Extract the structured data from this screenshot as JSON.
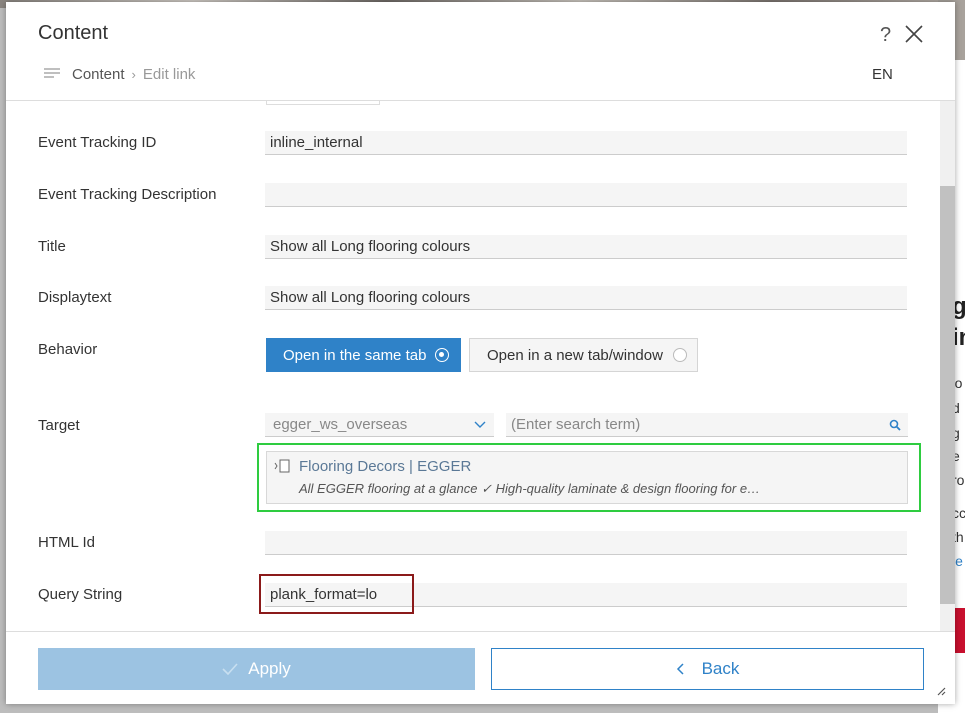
{
  "modal": {
    "title": "Content",
    "help_label": "?",
    "language": "EN",
    "breadcrumb": {
      "root": "Content",
      "separator": "›",
      "current": "Edit link"
    }
  },
  "fields": {
    "event_tracking_id": {
      "label": "Event Tracking ID",
      "value": "inline_internal"
    },
    "event_tracking_description": {
      "label": "Event Tracking Description",
      "value": ""
    },
    "title": {
      "label": "Title",
      "value": "Show all Long flooring colours"
    },
    "displaytext": {
      "label": "Displaytext",
      "value": "Show all Long flooring colours"
    },
    "behavior": {
      "label": "Behavior",
      "options": [
        "Open in the same tab",
        "Open in a new tab/window"
      ],
      "selected": "Open in the same tab"
    },
    "target": {
      "label": "Target",
      "site": "egger_ws_overseas",
      "search_placeholder": "(Enter search term)",
      "result_title": "Flooring Decors | EGGER",
      "result_description": "All EGGER flooring at a glance ✓ High-quality laminate & design flooring for e…"
    },
    "html_id": {
      "label": "HTML Id",
      "value": ""
    },
    "query_string": {
      "label": "Query String",
      "value": "plank_format=lo"
    }
  },
  "footer": {
    "apply_label": "Apply",
    "back_label": "Back"
  },
  "colors": {
    "primary": "#2f82c8",
    "apply_disabled": "#9cc3e2",
    "highlight_green": "#2ecc40",
    "highlight_red": "#8b1a1a"
  },
  "background_page": {
    "heading_fragments": [
      "g",
      "in"
    ],
    "text_fragments": [
      "'o",
      "d",
      "g",
      "e",
      "ro",
      "cc",
      "th",
      "le"
    ]
  }
}
